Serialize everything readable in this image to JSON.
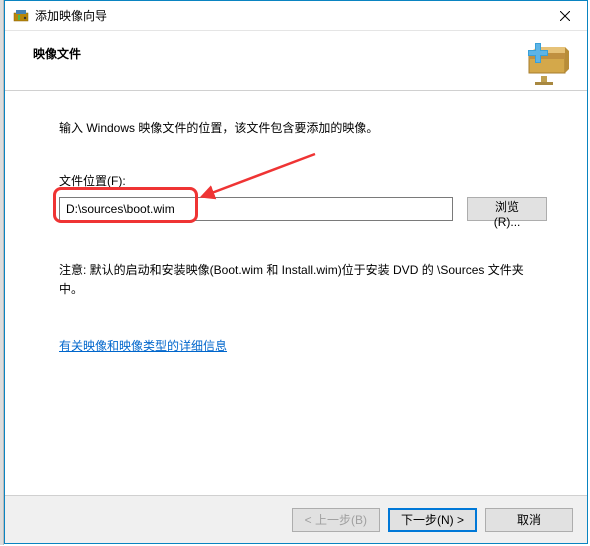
{
  "window": {
    "title": "添加映像向导"
  },
  "header": {
    "title": "映像文件"
  },
  "content": {
    "instruction": "输入 Windows 映像文件的位置，该文件包含要添加的映像。",
    "file_label": "文件位置(F):",
    "file_value": "D:\\sources\\boot.wim",
    "browse_label": "浏览(R)...",
    "note": "注意: 默认的启动和安装映像(Boot.wim 和 Install.wim)位于安装 DVD 的 \\Sources 文件夹中。",
    "link": "有关映像和映像类型的详细信息"
  },
  "footer": {
    "back": "< 上一步(B)",
    "next": "下一步(N) >",
    "cancel": "取消"
  }
}
